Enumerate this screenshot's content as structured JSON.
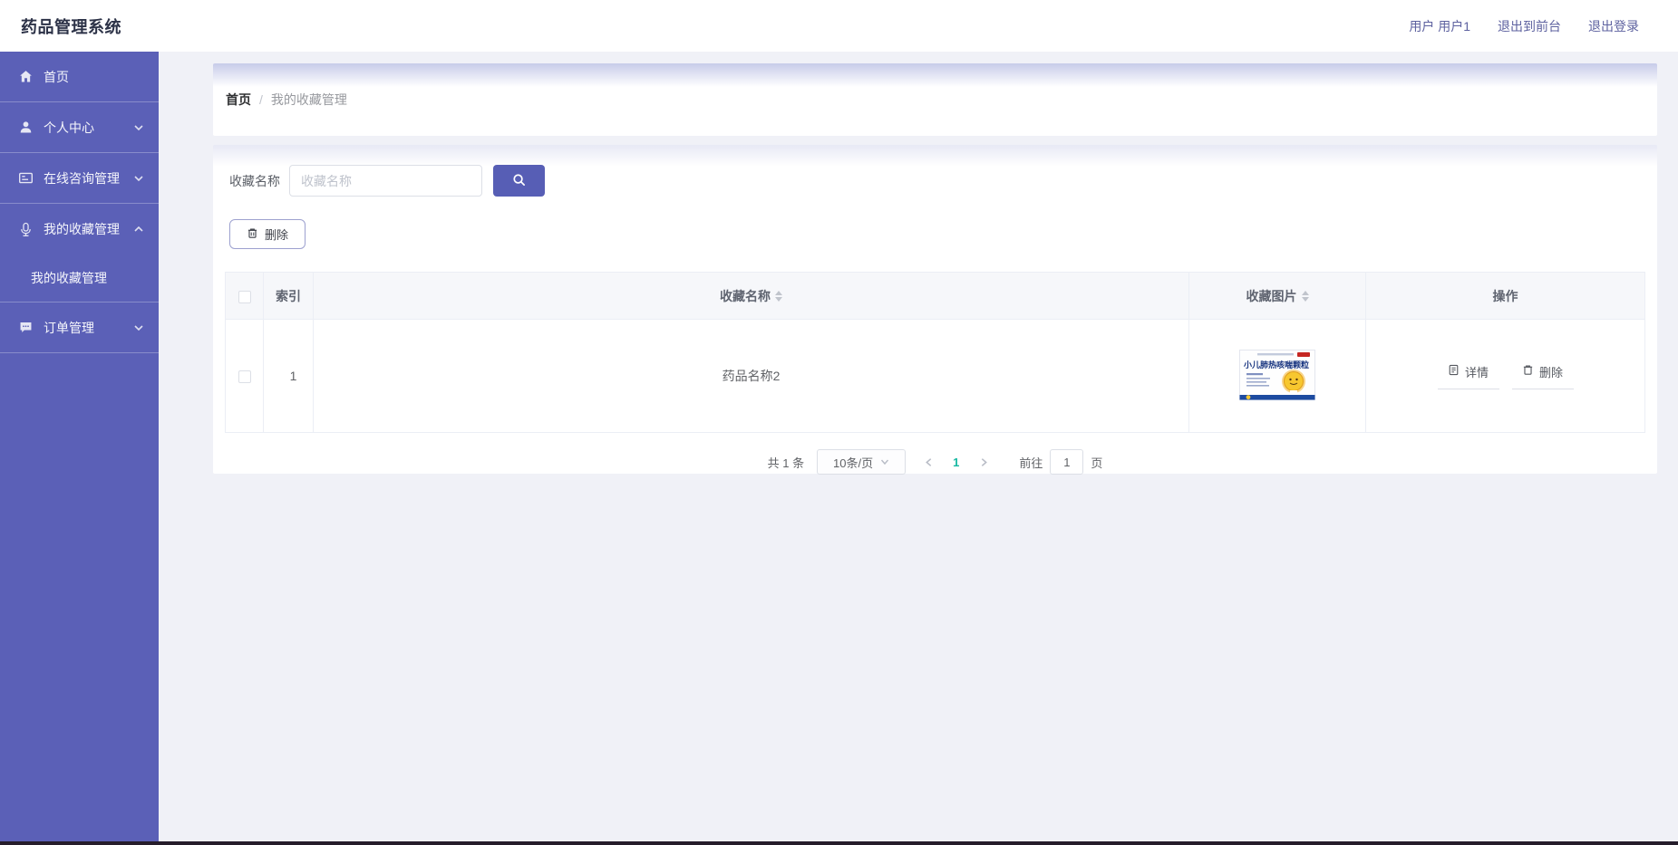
{
  "colors": {
    "sidebar": "#5b60b7",
    "accent": "#575eb5",
    "active_page": "#17b8a2",
    "header_link": "#5d619f",
    "main_bg": "#f0f1f7",
    "bottom_strip": "#261d2b"
  },
  "app": {
    "title": "药品管理系统"
  },
  "header": {
    "user_label": "用户 用户1",
    "exit_front_label": "退出到前台",
    "logout_label": "退出登录"
  },
  "sidebar": {
    "items": [
      {
        "label": "首页",
        "icon": "home-icon"
      },
      {
        "label": "个人中心",
        "icon": "user-icon",
        "chevron": "down"
      },
      {
        "label": "在线咨询管理",
        "icon": "form-icon",
        "chevron": "down"
      },
      {
        "label": "我的收藏管理",
        "icon": "microphone-icon",
        "chevron": "up",
        "children": [
          {
            "label": "我的收藏管理",
            "active": true
          }
        ]
      },
      {
        "label": "订单管理",
        "icon": "chat-icon",
        "chevron": "down"
      }
    ]
  },
  "breadcrumb": {
    "home": "首页",
    "separator": "/",
    "current": "我的收藏管理"
  },
  "search": {
    "label": "收藏名称",
    "placeholder": "收藏名称"
  },
  "toolbar": {
    "delete_label": "删除"
  },
  "table": {
    "columns": [
      {
        "label": "索引",
        "sortable": false
      },
      {
        "label": "收藏名称",
        "sortable": true
      },
      {
        "label": "收藏图片",
        "sortable": true
      },
      {
        "label": "操作",
        "sortable": false
      }
    ],
    "rows": [
      {
        "index": "1",
        "name": "药品名称2",
        "image_title": "小儿肺热咳喘颗粒",
        "detail_label": "详情",
        "delete_label": "删除"
      }
    ]
  },
  "pagination": {
    "total_text": "共 1 条",
    "page_size": "10条/页",
    "current_page": "1",
    "goto_label": "前往",
    "goto_value": "1",
    "page_unit": "页"
  }
}
